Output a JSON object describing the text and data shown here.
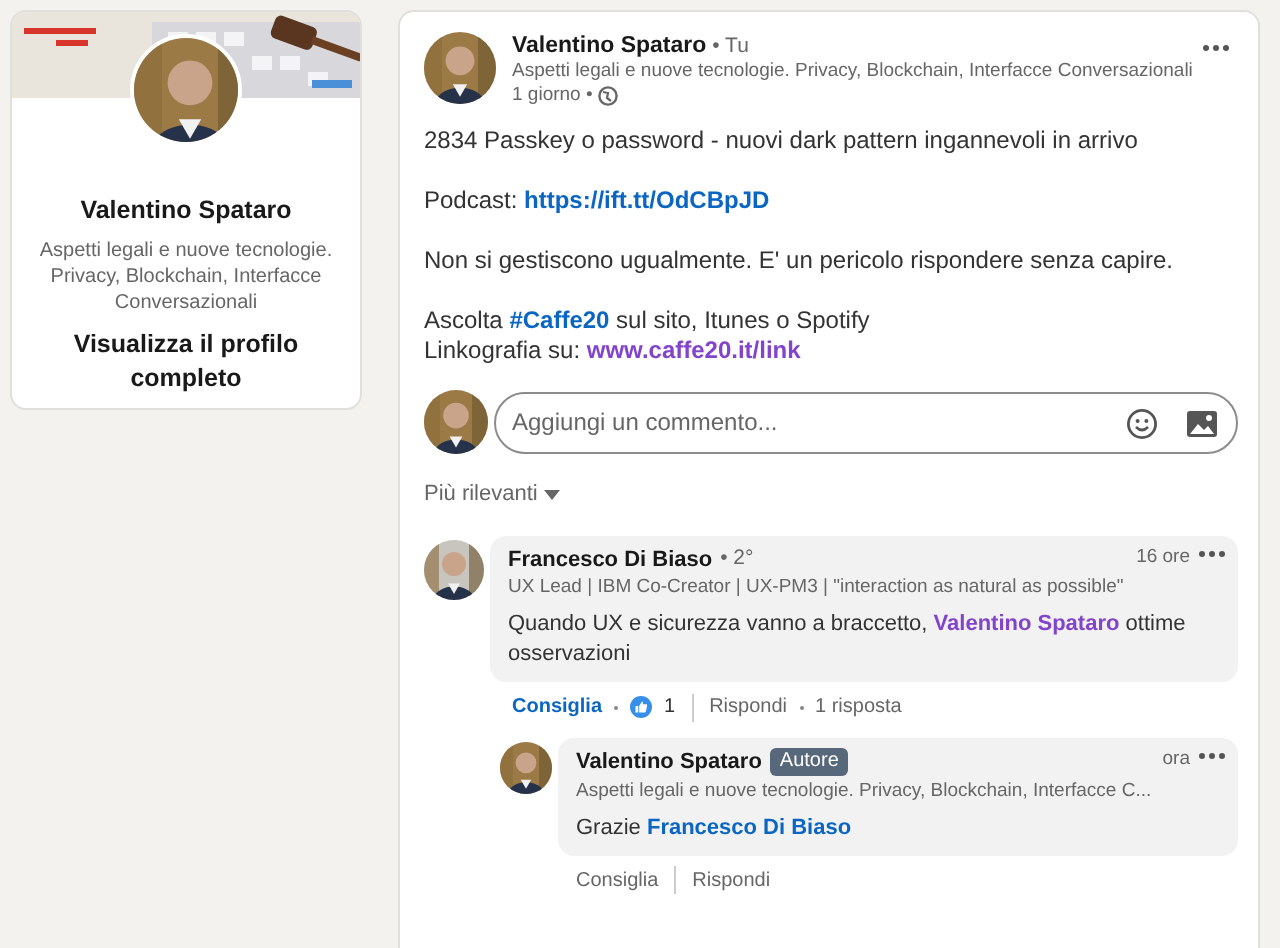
{
  "profile_card": {
    "banner": {
      "kind": "picture"
    },
    "avatar": {
      "kind": "picture"
    },
    "name": "Valentino Spataro",
    "headline": "Aspetti legali e nuove tecnologie. Privacy, Blockchain, Interfacce Conversazionali",
    "link": "Visualizza il profilo completo"
  },
  "post": {
    "avatar": {
      "kind": "picture"
    },
    "author": "Valentino Spataro",
    "relation": "• Tu",
    "headline": "Aspetti legali e nuove tecnologie. Privacy, Blockchain, Interfacce Conversazionali",
    "time": "1 giorno •",
    "body": [
      [
        {
          "text": "2834 Passkey o password - nuovi dark pattern ingannevoli in arrivo"
        }
      ],
      [
        {
          "text": "Podcast: "
        },
        {
          "link": "https://ift.tt/OdCBpJD",
          "visited": false
        }
      ],
      [
        {
          "text": "Non si gestiscono ugualmente. E' un pericolo rispondere senza capire."
        }
      ],
      [
        {
          "text": "Ascolta "
        },
        {
          "link": "#Caffe20",
          "visited": false
        },
        {
          "text": " sul sito, Itunes o Spotify"
        }
      ],
      [
        {
          "text": "Linkografia su: "
        },
        {
          "link": "www.caffe20.it/link",
          "visited": true
        }
      ]
    ]
  },
  "comment_box": {
    "placeholder": "Aggiungi un commento..."
  },
  "sort": {
    "label": "Più rilevanti"
  },
  "comments": [
    {
      "author": "Francesco Di Biaso",
      "relation": "• 2°",
      "headline": "UX Lead | IBM Co-Creator | UX-PM3 | \"interaction as natural as possible\"",
      "time": "16 ore",
      "body": [
        {
          "text": "Quando UX e sicurezza vanno a braccetto, "
        },
        {
          "link": "Valentino Spataro",
          "visited": true
        },
        {
          "text": " ottime osservazioni"
        }
      ],
      "like": {
        "label": "Consiglia",
        "liked": true
      },
      "reactions": "1",
      "reply": "Rispondi",
      "replies_count": "1 risposta",
      "replies": [
        {
          "author": "Valentino Spataro",
          "badge": "Autore",
          "headline": "Aspetti legali e nuove tecnologie. Privacy, Blockchain, Interfacce C...",
          "time": "ora",
          "body": [
            {
              "text": "Grazie "
            },
            {
              "link": "Francesco Di Biaso",
              "visited": false
            }
          ],
          "like": {
            "label": "Consiglia",
            "liked": false
          },
          "reply": "Rispondi"
        }
      ]
    }
  ]
}
